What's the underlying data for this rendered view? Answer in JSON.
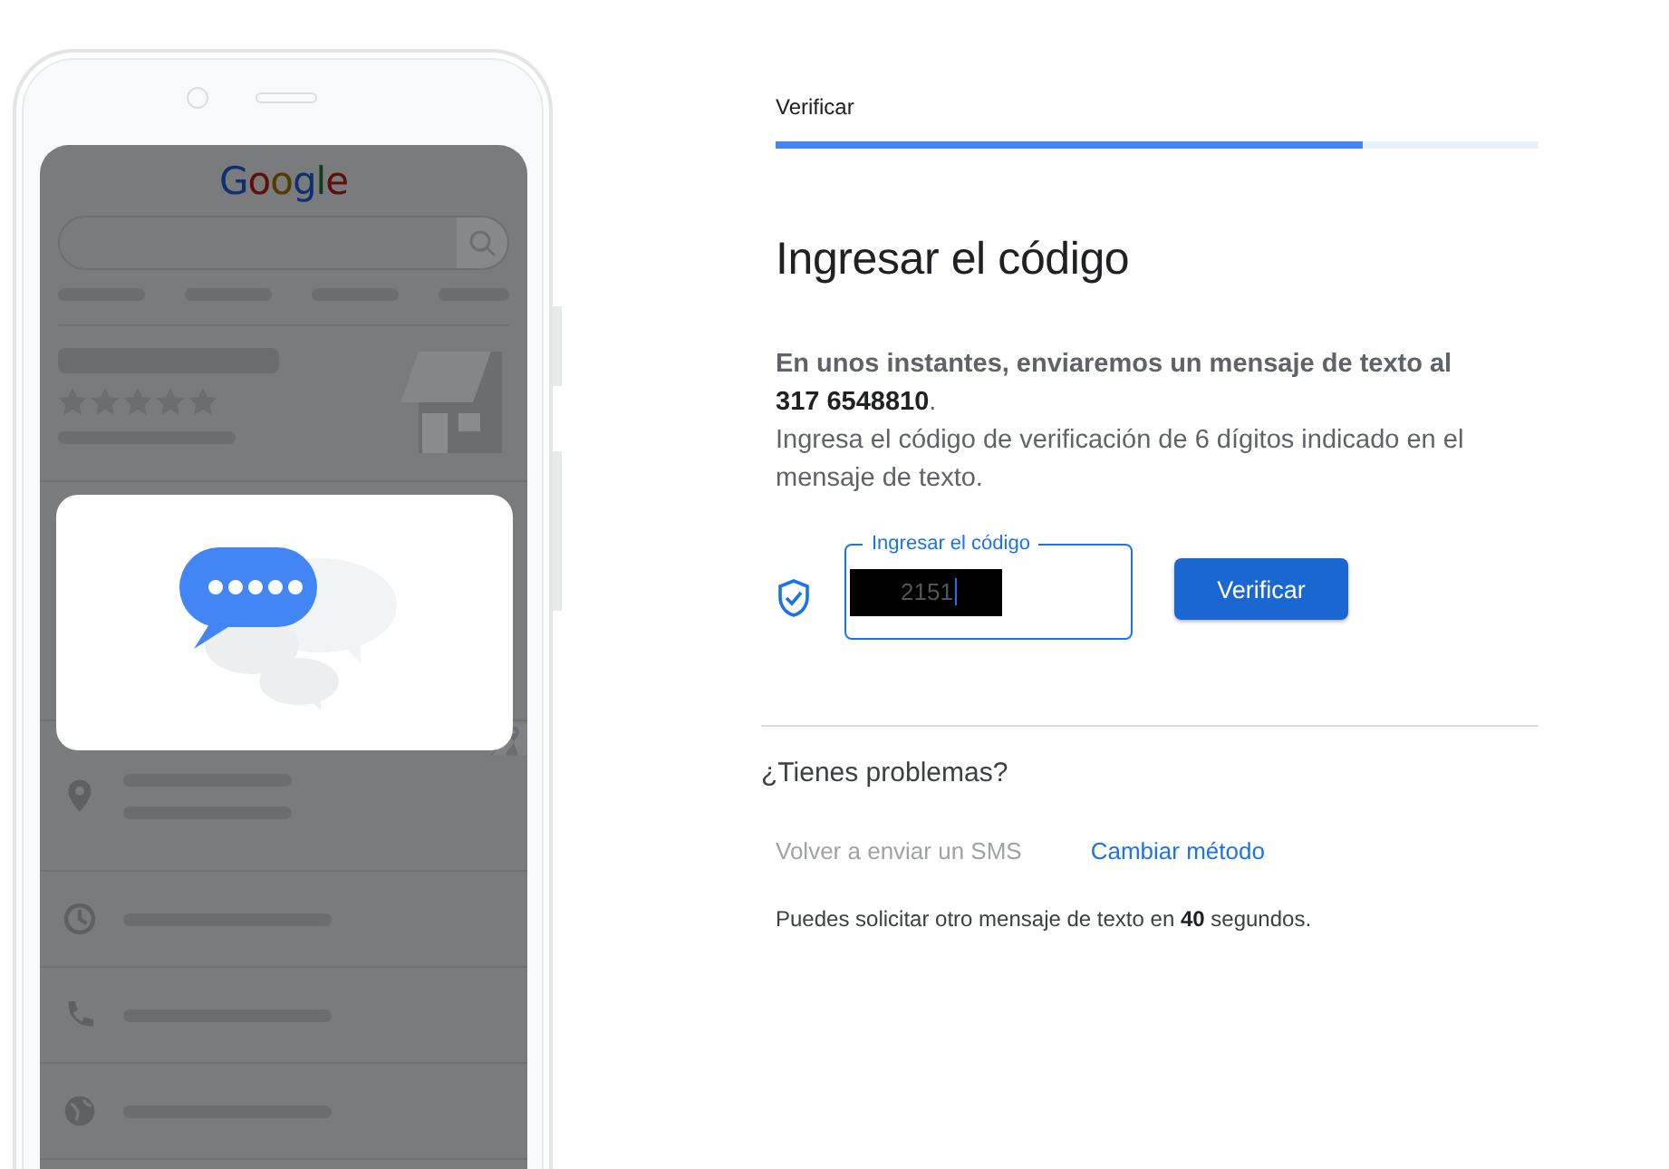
{
  "illustration": {
    "logo": "Google"
  },
  "step": {
    "label": "Verificar",
    "level": 0.77
  },
  "heading": "Ingresar el código",
  "message": [
    "**En unos instantes, enviaremos un mensaje de texto al**",
    "**317 6548810**.",
    "Ingresa el código de verificación de 6 dígitos indicado en el mensaje de texto."
  ],
  "code_field": {
    "label": "Ingresar el código",
    "value": "2151",
    "redacted": true
  },
  "verify_button": "Verificar",
  "help": {
    "title": "¿Tienes problemas?",
    "links": [
      {
        "label": "Volver a enviar un SMS",
        "disabled": true
      },
      {
        "label": "Cambiar método",
        "disabled": false
      }
    ],
    "note": "Puedes solicitar otro mensaje de texto en **40** segundos."
  }
}
